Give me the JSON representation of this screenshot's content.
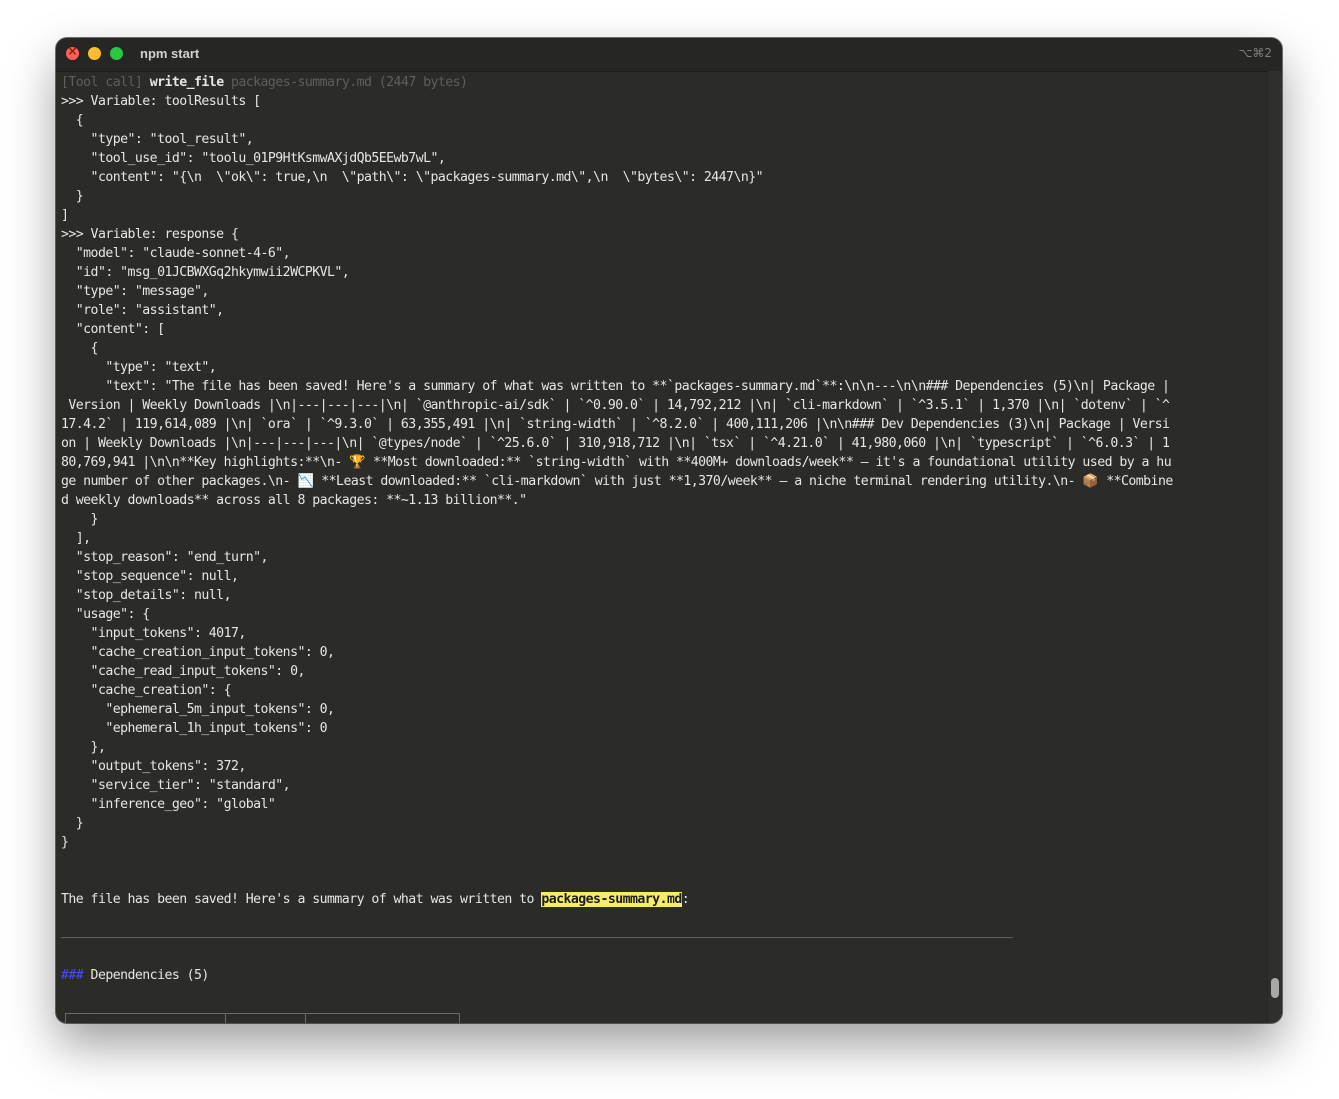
{
  "window": {
    "title": "npm start",
    "shortcut": "⌥⌘2"
  },
  "log": {
    "tool_call_prefix": "[Tool call]",
    "tool_name": "write_file",
    "tool_args": "packages-summary.md (2447 bytes)",
    "lines": [
      ">>> Variable: toolResults [",
      "  {",
      "    \"type\": \"tool_result\",",
      "    \"tool_use_id\": \"toolu_01P9HtKsmwAXjdQb5EEwb7wL\",",
      "    \"content\": \"{\\n  \\\"ok\\\": true,\\n  \\\"path\\\": \\\"packages-summary.md\\\",\\n  \\\"bytes\\\": 2447\\n}\"",
      "  }",
      "]",
      ">>> Variable: response {",
      "  \"model\": \"claude-sonnet-4-6\",",
      "  \"id\": \"msg_01JCBWXGq2hkymwii2WCPKVL\",",
      "  \"type\": \"message\",",
      "  \"role\": \"assistant\",",
      "  \"content\": [",
      "    {",
      "      \"type\": \"text\",",
      "      \"text\": \"The file has been saved! Here's a summary of what was written to **`packages-summary.md`**:\\n\\n---\\n\\n### Dependencies (5)\\n| Package |",
      " Version | Weekly Downloads |\\n|---|---|---|\\n| `@anthropic-ai/sdk` | `^0.90.0` | 14,792,212 |\\n| `cli-markdown` | `^3.5.1` | 1,370 |\\n| `dotenv` | `^",
      "17.4.2` | 119,614,089 |\\n| `ora` | `^9.3.0` | 63,355,491 |\\n| `string-width` | `^8.2.0` | 400,111,206 |\\n\\n### Dev Dependencies (3)\\n| Package | Versi",
      "on | Weekly Downloads |\\n|---|---|---|\\n| `@types/node` | `^25.6.0` | 310,918,712 |\\n| `tsx` | `^4.21.0` | 41,980,060 |\\n| `typescript` | `^6.0.3` | 1",
      "80,769,941 |\\n\\n**Key highlights:**\\n- ",
      "ge number of other packages.\\n- ",
      "d weekly downloads** across all 8 packages: **~1.13 billion**.\"",
      "    }",
      "  ],",
      "  \"stop_reason\": \"end_turn\",",
      "  \"stop_sequence\": null,",
      "  \"stop_details\": null,",
      "  \"usage\": {",
      "    \"input_tokens\": 4017,",
      "    \"cache_creation_input_tokens\": 0,",
      "    \"cache_read_input_tokens\": 0,",
      "    \"cache_creation\": {",
      "      \"ephemeral_5m_input_tokens\": 0,",
      "      \"ephemeral_1h_input_tokens\": 0",
      "    },",
      "    \"output_tokens\": 372,",
      "    \"service_tier\": \"standard\",",
      "    \"inference_geo\": \"global\"",
      "  }",
      "}"
    ],
    "highlight_line": {
      "trophy_emoji": "🏆",
      "after_trophy": " **Most downloaded:** `string-width` with **400M+ downloads/week** — it's a foundational utility used by a hu",
      "chart_emoji": "📉",
      "after_chart": " **Least downloaded:** `cli-markdown` with just **1,370/week** — a niche terminal rendering utility.\\n- ",
      "box_emoji": "📦",
      "after_box": " **Combine"
    }
  },
  "rendered": {
    "saved_prefix": "The file has been saved! Here's a summary of what was written to ",
    "saved_file": "packages-summary.md",
    "saved_suffix": ":",
    "heading_hashes": "###",
    "heading_text": " Dependencies (5)"
  }
}
